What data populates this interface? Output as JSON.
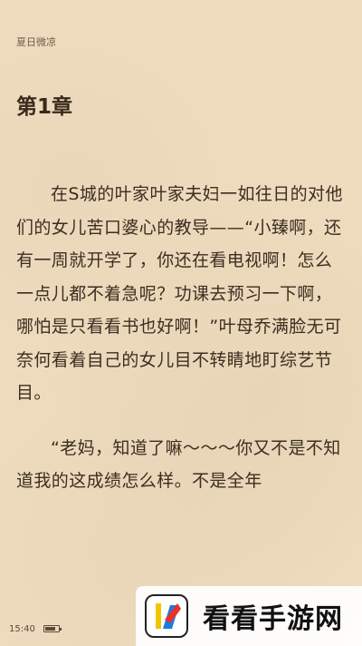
{
  "book": {
    "title": "夏日微凉"
  },
  "chapter": {
    "title": "第1章",
    "paragraphs": [
      "在S城的叶家叶家夫妇一如往日的对他们的女儿苦口婆心的教导——“小臻啊，还有一周就开学了，你还在看电视啊！怎么一点儿都不着急呢？功课去预习一下啊，哪怕是只看看书也好啊！”叶母乔满脸无可奈何看着自己的女儿目不转睛地盯综艺节目。",
      "“老妈，知道了嘛～～～你又不是不知道我的这成绩怎么样。不是全年"
    ]
  },
  "status": {
    "time": "15:40",
    "battery_level": 0.8
  },
  "watermark": {
    "brand": "看看手游网",
    "logo_icon": "kankan-logo-icon",
    "colors": {
      "red": "#e8312a",
      "blue": "#1c7be0",
      "yellow": "#f5c400"
    }
  }
}
